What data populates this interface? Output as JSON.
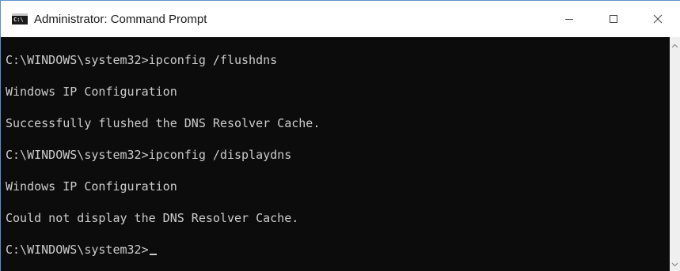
{
  "window": {
    "title": "Administrator: Command Prompt",
    "icon": "console-app-icon",
    "icon_glyph": "C:\\",
    "controls": {
      "minimize_icon": "minimize-icon",
      "maximize_icon": "maximize-icon",
      "close_icon": "close-icon"
    }
  },
  "console": {
    "lines": [
      "C:\\WINDOWS\\system32>ipconfig /flushdns",
      "",
      "Windows IP Configuration",
      "",
      "Successfully flushed the DNS Resolver Cache.",
      "",
      "C:\\WINDOWS\\system32>ipconfig /displaydns",
      "",
      "Windows IP Configuration",
      "",
      "Could not display the DNS Resolver Cache.",
      "",
      "C:\\WINDOWS\\system32>"
    ],
    "background": "#0c0c0c",
    "foreground": "#cccccc"
  },
  "scrollbar": {
    "up_icon": "scroll-up-arrow-icon",
    "down_icon": "scroll-down-arrow-icon"
  }
}
